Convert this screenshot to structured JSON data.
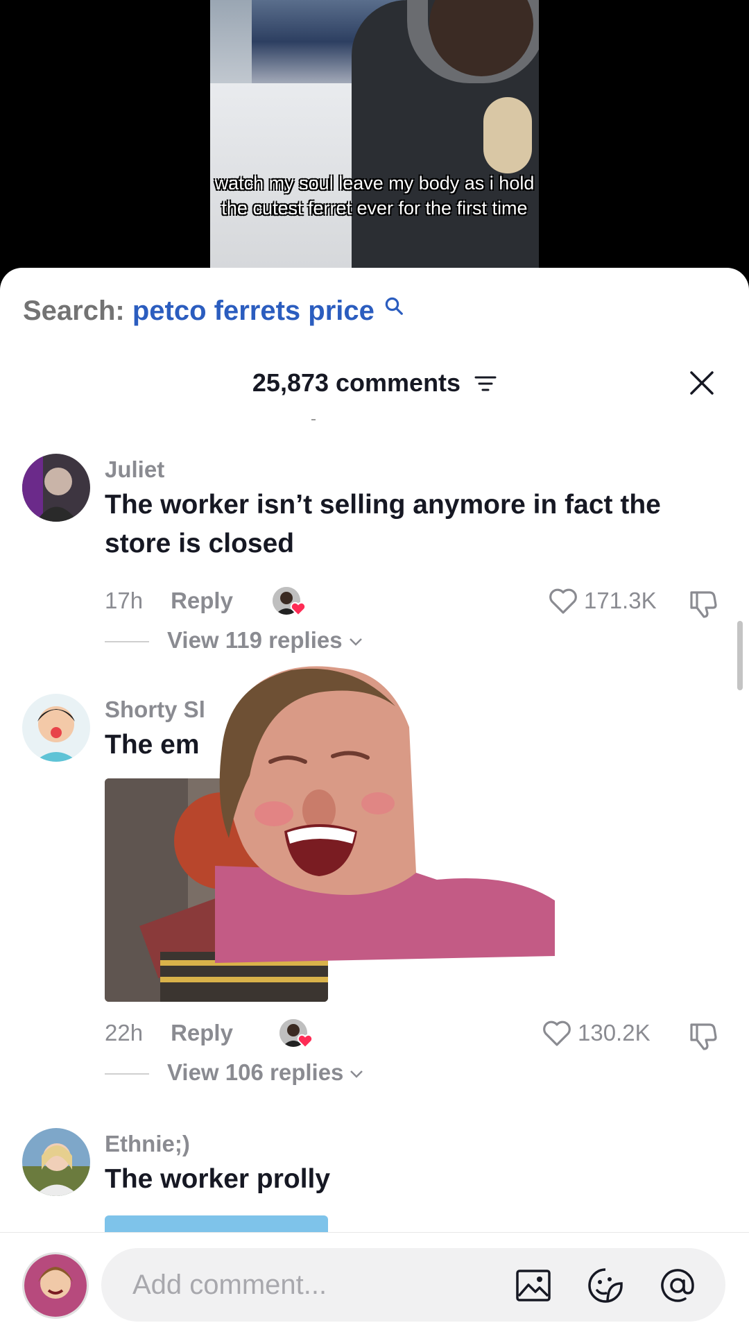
{
  "video": {
    "caption": "watch my soul leave my body as i hold the cutest ferret ever for the first time"
  },
  "search": {
    "label": "Search:",
    "term": "petco ferrets price"
  },
  "header": {
    "comment_count": "25,873 comments"
  },
  "comments": [
    {
      "username": "Juliet",
      "text": "The worker isn’t selling anymore in fact the store is closed",
      "time": "17h",
      "reply_label": "Reply",
      "likes": "171.3K",
      "view_replies": "View 119 replies"
    },
    {
      "username": "Shorty Sl",
      "text": "The em",
      "time": "22h",
      "reply_label": "Reply",
      "likes": "130.2K",
      "view_replies": "View 106 replies"
    },
    {
      "username": "Ethnie;)",
      "text": "The worker prolly"
    }
  ],
  "composer": {
    "placeholder": "Add comment..."
  },
  "colors": {
    "search_term": "#2b5dbf",
    "heart_red": "#fe2c55",
    "muted_text": "#8a8b91"
  }
}
